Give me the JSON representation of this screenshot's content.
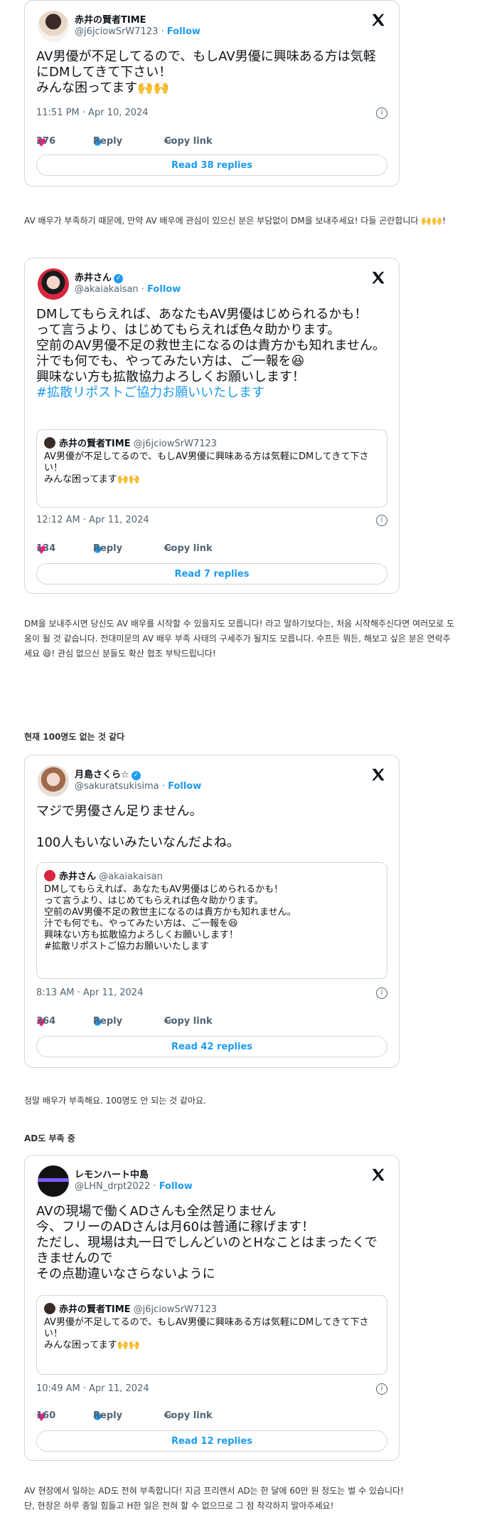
{
  "tweets": [
    {
      "name": "赤井の賢者TIME",
      "handle": "@j6jciowSrW7123",
      "follow": "Follow",
      "body": "AV男優が不足してるので、もしAV男優に興味ある方は気軽にDMしてきて下さい！\nみんな困ってます🙌🙌",
      "time": "11:51 PM · Apr 10, 2024",
      "likes": "276",
      "reply": "Reply",
      "copy": "Copy link",
      "read": "Read 38 replies"
    },
    {
      "name": "赤井さん",
      "handle": "@akaiakaisan",
      "follow": "Follow",
      "body": "DMしてもらえれば、あなたもAV男優はじめられるかも！\nって言うより、はじめてもらえれば色々助かります。\n空前のAV男優不足の救世主になるのは貴方かも知れません。\n汁でも何でも、やってみたい方は、ご一報を😆\n興味ない方も拡散協力よろしくお願いします！",
      "hashtag": "#拡散リポストご協力お願いいたします",
      "quote_name": "赤井の賢者TIME",
      "quote_handle": "@j6jciowSrW7123",
      "quote_body": "AV男優が不足してるので、もしAV男優に興味ある方は気軽にDMしてきて下さい！\nみんな困ってます🙌🙌",
      "time": "12:12 AM · Apr 11, 2024",
      "likes": "134",
      "reply": "Reply",
      "copy": "Copy link",
      "read": "Read 7 replies"
    },
    {
      "name": "月島さくら☆",
      "handle": "@sakuratsukisima",
      "follow": "Follow",
      "body": "マジで男優さん足りません。\n\n100人もいないみたいなんだよね。",
      "quote_name": "赤井さん",
      "quote_handle": "@akaiakaisan",
      "quote_body": "DMしてもらえれば、あなたもAV男優はじめられるかも！\nって言うより、はじめてもらえれば色々助かります。\n空前のAV男優不足の救世主になるのは貴方かも知れません。\n汁でも何でも、やってみたい方は、ご一報を😆\n興味ない方も拡散協力よろしくお願いします！\n#拡散リポストご協力お願いいたします",
      "time": "8:13 AM · Apr 11, 2024",
      "likes": "364",
      "reply": "Reply",
      "copy": "Copy link",
      "read": "Read 42 replies"
    },
    {
      "name": "レモンハート中島",
      "handle": "@LHN_drpt2022",
      "follow": "Follow",
      "body": "AVの現場で働くADさんも全然足りません\n今、フリーのADさんは月60は普通に稼げます！\nただし、現場は丸一日でしんどいのとHなことはまったくできませんので\nその点勘違いなさらないように",
      "quote_name": "赤井の賢者TIME",
      "quote_handle": "@j6jciowSrW7123",
      "quote_body": "AV男優が不足してるので、もしAV男優に興味ある方は気軽にDMしてきて下さい！\nみんな困ってます🙌🙌",
      "time": "10:49 AM · Apr 11, 2024",
      "likes": "160",
      "reply": "Reply",
      "copy": "Copy link",
      "read": "Read 12 replies"
    }
  ],
  "korean": {
    "t1": "AV 배우가 부족하기 때문에, 만약 AV 배우에 관심이 있으신 분은 부담없이 DM을 보내주세요! 다들 곤란합니다 🙌🙌!",
    "t2": "DM을 보내주시면 당신도 AV 배우를 시작할 수 있을지도 모릅니다! 라고 말하기보다는, 처음 시작해주신다면 여러모로 도움이 될 것 같습니다. 전대미문의 AV 배우 부족 사태의 구세주가 될지도 모릅니다. 수프든 뭐든, 해보고 싶은 분은 연락주세요 😆! 관심 없으신 분들도 확산 협조 부탁드립니다!",
    "h1": "현재 100명도 없는 것 같다",
    "t3": "정말 배우가 부족해요. 100명도 안 되는 것 같아요.",
    "h2": "AD도 부족 중",
    "t4": "AV 현장에서 일하는 AD도 전혀 부족합니다! 지금 프리랜서 AD는 한 달에 60만 원 정도는 벌 수 있습니다!\n단, 현장은 하루 종일 힘들고 H한 일은 전혀 할 수 없으므로 그 점 착각하지 말아주세요!"
  }
}
